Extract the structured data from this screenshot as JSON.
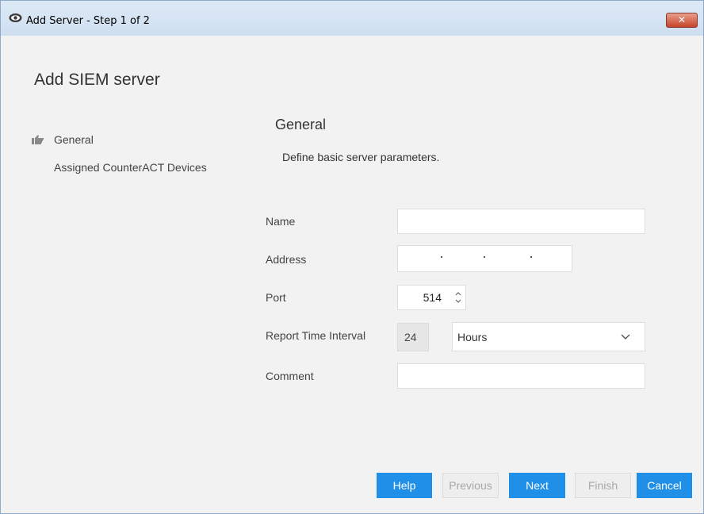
{
  "window": {
    "title": "Add Server - Step 1 of 2",
    "close_label": "✕",
    "icon": "eye-icon"
  },
  "dialog": {
    "heading": "Add SIEM server"
  },
  "steps_nav": {
    "items": [
      {
        "label": "General",
        "active": true,
        "icon": "thumbs-pointer-icon"
      },
      {
        "label": "Assigned CounterACT Devices",
        "active": false
      }
    ]
  },
  "section": {
    "title": "General",
    "description": "Define basic server parameters."
  },
  "form": {
    "name": {
      "label": "Name",
      "value": ""
    },
    "address": {
      "label": "Address",
      "value": ""
    },
    "port": {
      "label": "Port",
      "value": "514"
    },
    "report_interval": {
      "label": "Report Time Interval",
      "value": "24",
      "unit": "Hours"
    },
    "comment": {
      "label": "Comment",
      "value": ""
    }
  },
  "buttons": {
    "help": "Help",
    "previous": "Previous",
    "next": "Next",
    "finish": "Finish",
    "cancel": "Cancel"
  },
  "colors": {
    "primary_button": "#1f8fe8",
    "disabled_button_text": "#a8a8a8",
    "title_bar": "#dde9f6",
    "close_button": "#c5432a"
  }
}
